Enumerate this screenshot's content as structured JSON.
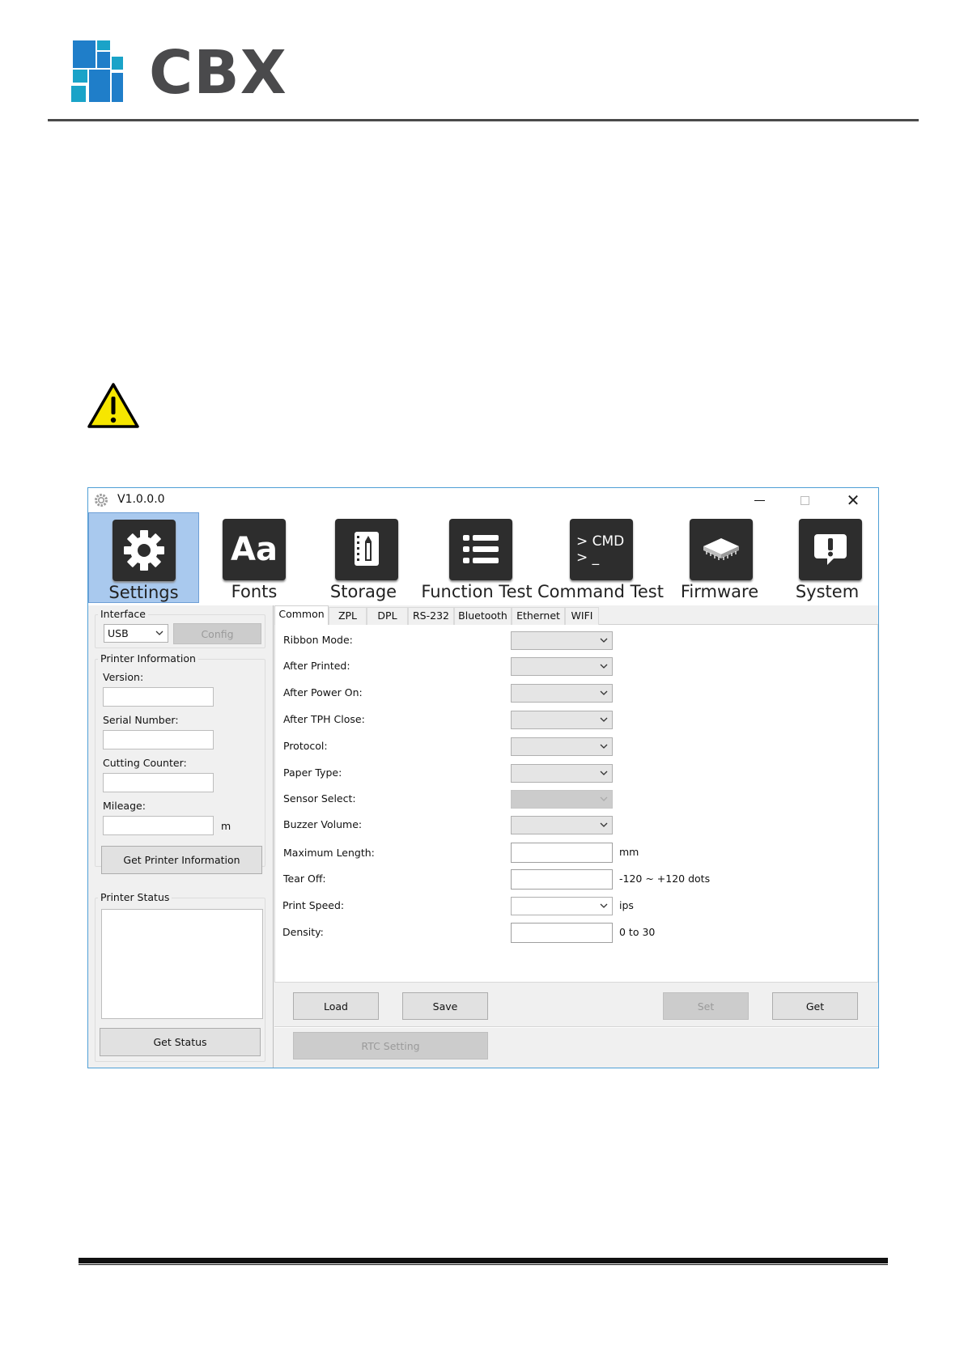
{
  "document": {
    "logo_text": "CBX",
    "brand_colors": {
      "logo_blue": "#1f7ec9",
      "logo_teal": "#1aa3c8",
      "logo_gray": "#4a4a4c"
    }
  },
  "app": {
    "title": "V1.0.0.0",
    "window_controls": {
      "minimize_icon": "minimize-icon",
      "maximize_icon": "maximize-icon",
      "close_icon": "close-icon"
    },
    "toolbar": [
      {
        "label": "Settings",
        "icon": "gear-icon",
        "active": true
      },
      {
        "label": "Fonts",
        "icon": "font-aa-icon",
        "active": false
      },
      {
        "label": "Storage",
        "icon": "storage-pencil-icon",
        "active": false
      },
      {
        "label": "Function Test",
        "icon": "list-icon",
        "active": false
      },
      {
        "label": "Command Test",
        "icon": "cmd-icon",
        "cmd_line1": "> CMD",
        "cmd_line2": "> _",
        "active": false
      },
      {
        "label": "Firmware",
        "icon": "chip-icon",
        "active": false
      },
      {
        "label": "System",
        "icon": "alert-bubble-icon",
        "active": false
      }
    ],
    "left_panel": {
      "interface_title": "Interface",
      "interface_value": "USB",
      "config_button": "Config",
      "printer_info_title": "Printer Information",
      "version_label": "Version:",
      "version_value": "",
      "serial_label": "Serial Number:",
      "serial_value": "",
      "cutting_label": "Cutting Counter:",
      "cutting_value": "",
      "mileage_label": "Mileage:",
      "mileage_value": "",
      "mileage_unit": "m",
      "get_info_button": "Get Printer Information",
      "status_title": "Printer Status",
      "status_text": "",
      "get_status_button": "Get Status"
    },
    "tabs": [
      {
        "label": "Common",
        "active": true
      },
      {
        "label": "ZPL",
        "active": false
      },
      {
        "label": "DPL",
        "active": false
      },
      {
        "label": "RS-232",
        "active": false
      },
      {
        "label": "Bluetooth",
        "active": false
      },
      {
        "label": "Ethernet",
        "active": false
      },
      {
        "label": "WIFI",
        "active": false
      }
    ],
    "common": {
      "ribbon_mode": "Ribbon Mode:",
      "after_printed": "After Printed:",
      "after_power_on": "After Power On:",
      "after_tph_close": "After TPH Close:",
      "protocol": "Protocol:",
      "paper_type": "Paper Type:",
      "sensor_select": "Sensor Select:",
      "buzzer_volume": "Buzzer Volume:",
      "maximum_length": "Maximum Length:",
      "maximum_length_unit": "mm",
      "tear_off": "Tear Off:",
      "tear_off_unit": "-120 ~ +120 dots",
      "print_speed": "Print Speed:",
      "print_speed_unit": "ips",
      "density": "Density:",
      "density_unit": "0 to 30"
    },
    "buttons": {
      "load": "Load",
      "save": "Save",
      "set": "Set",
      "get": "Get",
      "rtc_setting": "RTC Setting"
    }
  }
}
